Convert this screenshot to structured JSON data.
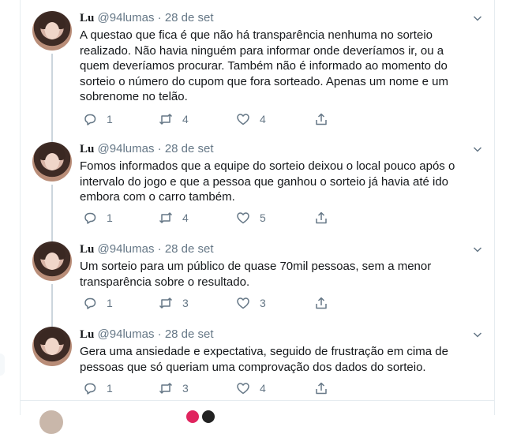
{
  "tweets": [
    {
      "name": "Lu",
      "handle": "@94lumas",
      "separator": "·",
      "time": "28 de set",
      "text": "A questao que fica é que não há transparência nenhuma no sorteio\nrealizado. Não havia ninguém para informar onde deveríamos ir, ou a\nquem deveríamos procurar. Também não é informado ao momento do\nsorteio o número do cupom que fora sorteado. Apenas um nome e um\nsobrenome no telão.",
      "replies": "1",
      "retweets": "4",
      "likes": "4"
    },
    {
      "name": "Lu",
      "handle": "@94lumas",
      "separator": "·",
      "time": "28 de set",
      "text": "Fomos informados que a equipe do sorteio deixou o local pouco após o\nintervalo do jogo e que a pessoa que ganhou o sorteio já havia até ido\nembora com o carro também.",
      "replies": "1",
      "retweets": "4",
      "likes": "5"
    },
    {
      "name": "Lu",
      "handle": "@94lumas",
      "separator": "·",
      "time": "28 de set",
      "text": "Um sorteio para um público de quase 70mil pessoas, sem a menor\ntransparência sobre o resultado.",
      "replies": "1",
      "retweets": "3",
      "likes": "3"
    },
    {
      "name": "Lu",
      "handle": "@94lumas",
      "separator": "·",
      "time": "28 de set",
      "text": "Gera uma ansiedade e expectativa, seguido de frustração em cima de\npessoas que só queriam uma comprovação dos dados do sorteio.",
      "replies": "1",
      "retweets": "3",
      "likes": "4"
    }
  ],
  "icons": {
    "reply": "reply-icon",
    "retweet": "retweet-icon",
    "like": "heart-icon",
    "share": "share-icon",
    "menu": "chevron-down-icon"
  },
  "colors": {
    "text": "#14171a",
    "secondary": "#657786",
    "border": "#e6ecf0",
    "thread_line": "#ccd6dd"
  }
}
